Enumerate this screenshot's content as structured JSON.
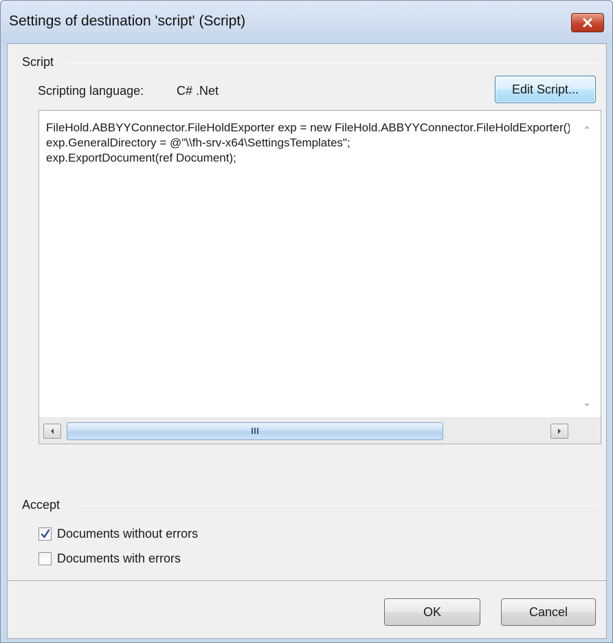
{
  "window": {
    "title": "Settings of destination 'script' (Script)"
  },
  "script_group": {
    "label": "Script",
    "language_label": "Scripting language:",
    "language_value": "C# .Net",
    "edit_button": "Edit Script...",
    "code": "FileHold.ABBYYConnector.FileHoldExporter exp = new FileHold.ABBYYConnector.FileHoldExporter();\nexp.GeneralDirectory = @\"\\\\fh-srv-x64\\SettingsTemplates\";\nexp.ExportDocument(ref Document);"
  },
  "accept_group": {
    "label": "Accept",
    "options": [
      {
        "label": "Documents without errors",
        "checked": true
      },
      {
        "label": "Documents with errors",
        "checked": false
      }
    ]
  },
  "buttons": {
    "ok": "OK",
    "cancel": "Cancel"
  },
  "icons": {
    "close": "close-icon",
    "check": "checkmark-icon",
    "scroll_left": "chevron-left-icon",
    "scroll_right": "chevron-right-icon",
    "scroll_up": "chevron-up-icon",
    "scroll_down": "chevron-down-icon"
  },
  "colors": {
    "title_bar": "#c9d9ec",
    "close_button": "#c9452e",
    "dialog_bg": "#f0f0f0",
    "scroll_thumb": "#b3d1ef"
  }
}
